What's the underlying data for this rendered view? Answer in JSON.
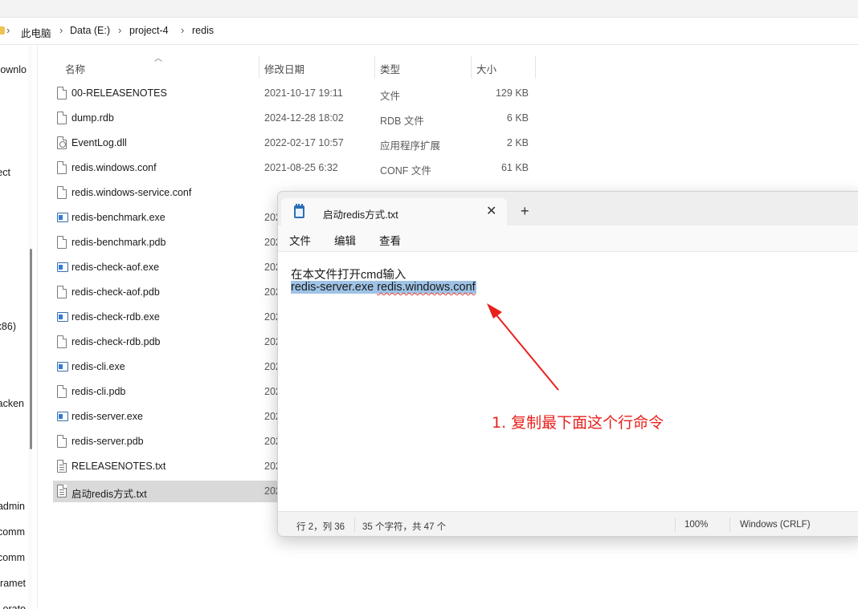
{
  "breadcrumb": [
    "此电脑",
    "Data (E:)",
    "project-4",
    "redis"
  ],
  "nav_pane": {
    "items": [
      "ownlo",
      "ect",
      "x86)",
      "acken",
      "admin",
      "comm",
      "comm",
      "aramet",
      "orato"
    ]
  },
  "columns": {
    "name": "名称",
    "date": "修改日期",
    "type": "类型",
    "size": "大小"
  },
  "files": [
    {
      "name": "00-RELEASENOTES",
      "date": "2021-10-17 19:11",
      "type": "文件",
      "size": "129 KB",
      "icon": "file-icon"
    },
    {
      "name": "dump.rdb",
      "date": "2024-12-28 18:02",
      "type": "RDB 文件",
      "size": "6 KB",
      "icon": "file-icon"
    },
    {
      "name": "EventLog.dll",
      "date": "2022-02-17 10:57",
      "type": "应用程序扩展",
      "size": "2 KB",
      "icon": "dll-icon"
    },
    {
      "name": "redis.windows.conf",
      "date": "2021-08-25 6:32",
      "type": "CONF 文件",
      "size": "61 KB",
      "icon": "file-icon"
    },
    {
      "name": "redis.windows-service.conf",
      "date": "",
      "type": "",
      "size": "",
      "icon": "file-icon"
    },
    {
      "name": "redis-benchmark.exe",
      "date": "202",
      "type": "",
      "size": "",
      "icon": "exe-icon"
    },
    {
      "name": "redis-benchmark.pdb",
      "date": "202",
      "type": "",
      "size": "",
      "icon": "file-icon"
    },
    {
      "name": "redis-check-aof.exe",
      "date": "202",
      "type": "",
      "size": "",
      "icon": "exe-icon"
    },
    {
      "name": "redis-check-aof.pdb",
      "date": "202",
      "type": "",
      "size": "",
      "icon": "file-icon"
    },
    {
      "name": "redis-check-rdb.exe",
      "date": "202",
      "type": "",
      "size": "",
      "icon": "exe-icon"
    },
    {
      "name": "redis-check-rdb.pdb",
      "date": "202",
      "type": "",
      "size": "",
      "icon": "file-icon"
    },
    {
      "name": "redis-cli.exe",
      "date": "202",
      "type": "",
      "size": "",
      "icon": "exe-icon"
    },
    {
      "name": "redis-cli.pdb",
      "date": "202",
      "type": "",
      "size": "",
      "icon": "file-icon"
    },
    {
      "name": "redis-server.exe",
      "date": "202",
      "type": "",
      "size": "",
      "icon": "exe-icon"
    },
    {
      "name": "redis-server.pdb",
      "date": "202",
      "type": "",
      "size": "",
      "icon": "file-icon"
    },
    {
      "name": "RELEASENOTES.txt",
      "date": "202",
      "type": "",
      "size": "",
      "icon": "txt-icon"
    },
    {
      "name": "启动redis方式.txt",
      "date": "202",
      "type": "",
      "size": "",
      "icon": "txt-icon",
      "selected": true
    }
  ],
  "notepad": {
    "tab_title": "启动redis方式.txt",
    "menu": [
      "文件",
      "编辑",
      "查看"
    ],
    "line1_prefix": "在本文件打开",
    "line1_cmd": "cmd",
    "line1_suffix": "输入",
    "line2_part1": "redis-server.exe ",
    "line2_part2": "redis.windows.conf",
    "status": {
      "position": "行 2，列 36",
      "chars": "35 个字符，共 47 个",
      "zoom": "100%",
      "line_ending": "Windows (CRLF)"
    }
  },
  "annotation": {
    "text": "1. 复制最下面这个行命令",
    "color": "#e8211d"
  },
  "colors": {
    "selection": "#9fc3e6",
    "row_selected": "#d9d9d9",
    "accent_exe": "#2f7bd6"
  }
}
